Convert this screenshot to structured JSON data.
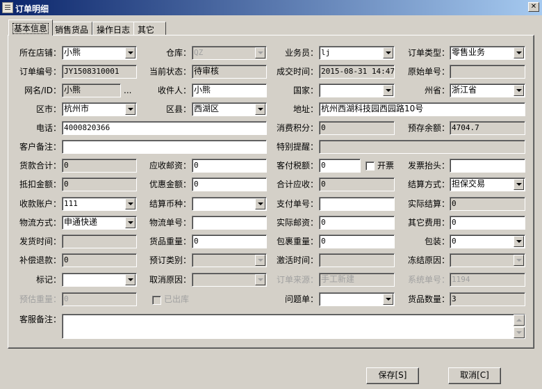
{
  "window": {
    "title": "订单明细",
    "close_glyph": "✕"
  },
  "tabs": [
    "基本信息",
    "销售货品",
    "操作日志",
    "其它"
  ],
  "form": {
    "store_label": "所在店铺：",
    "store": "小熊",
    "warehouse_label": "仓库：",
    "warehouse": "QZ",
    "salesman_label": "业务员：",
    "salesman": "lj",
    "order_type_label": "订单类型：",
    "order_type": "零售业务",
    "order_no_label": "订单编号：",
    "order_no": "JY1508310001",
    "status_label": "当前状态：",
    "status": "待审核",
    "deal_time_label": "成交时间：",
    "deal_time": "2015-08-31 14:47:5",
    "orig_no_label": "原始单号：",
    "orig_no": "",
    "netname_label": "网名/ID：",
    "netname": "小熊",
    "netname_more": "...",
    "receiver_label": "收件人：",
    "receiver": "小熊",
    "country_label": "国家：",
    "country": "",
    "province_label": "州省：",
    "province": "浙江省",
    "city_label": "区市：",
    "city": "杭州市",
    "district_label": "区县：",
    "district": "西湖区",
    "address_label": "地址：",
    "address": "杭州西湖科技园西园路10号",
    "phone_label": "电话：",
    "phone": "4000820366",
    "points_label": "消费积分：",
    "points": "0",
    "prepay_label": "预存余额：",
    "prepay": "4704.7",
    "cust_remark_label": "客户备注：",
    "cust_remark": "",
    "special_label": "特别提醒：",
    "special": "",
    "goods_total_label": "货款合计：",
    "goods_total": "0",
    "postage_label": "应收邮资：",
    "postage": "0",
    "tax_label": "客付税额：",
    "tax": "0",
    "invoice_chk_label": "开票",
    "invoice_title_label": "发票抬头：",
    "invoice_title": "",
    "deduct_label": "抵扣金额：",
    "deduct": "0",
    "discount_label": "优惠金额：",
    "discount": "0",
    "receivable_label": "合计应收：",
    "receivable": "0",
    "settle_label": "结算方式：",
    "settle": "担保交易",
    "account_label": "收款账户：",
    "account": "111",
    "currency_label": "结算币种：",
    "currency": "",
    "pay_no_label": "支付单号：",
    "pay_no": "",
    "actual_settle_label": "实际结算：",
    "actual_settle": "0",
    "logistics_label": "物流方式：",
    "logistics": "申通快递",
    "logistics_no_label": "物流单号：",
    "logistics_no": "",
    "actual_postage_label": "实际邮资：",
    "actual_postage": "0",
    "other_fee_label": "其它费用：",
    "other_fee": "0",
    "ship_time_label": "发货时间：",
    "ship_time": "",
    "weight_label": "货品重量：",
    "weight": "0",
    "pkg_weight_label": "包裹重量：",
    "pkg_weight": "0",
    "pack_label": "包装：",
    "pack": "0",
    "refund_label": "补偿退款：",
    "refund": "0",
    "preorder_label": "预订类别：",
    "preorder": "",
    "activate_label": "激活时间：",
    "activate": "",
    "freeze_label": "冻结原因：",
    "freeze": "",
    "mark_label": "标记：",
    "mark": "",
    "cancel_reason_label": "取消原因：",
    "cancel_reason": "",
    "source_label": "订单来源：",
    "source": "手工新建",
    "sys_no_label": "系统单号：",
    "sys_no": "1194",
    "est_weight_label": "预估重量：",
    "est_weight": "0",
    "shipped_chk_label": "已出库",
    "problem_label": "问题单：",
    "problem": "",
    "qty_label": "货品数量：",
    "qty": "3",
    "service_remark_label": "客服备注：",
    "service_remark": ""
  },
  "buttons": {
    "save": "保存[S]",
    "cancel": "取消[C]"
  }
}
